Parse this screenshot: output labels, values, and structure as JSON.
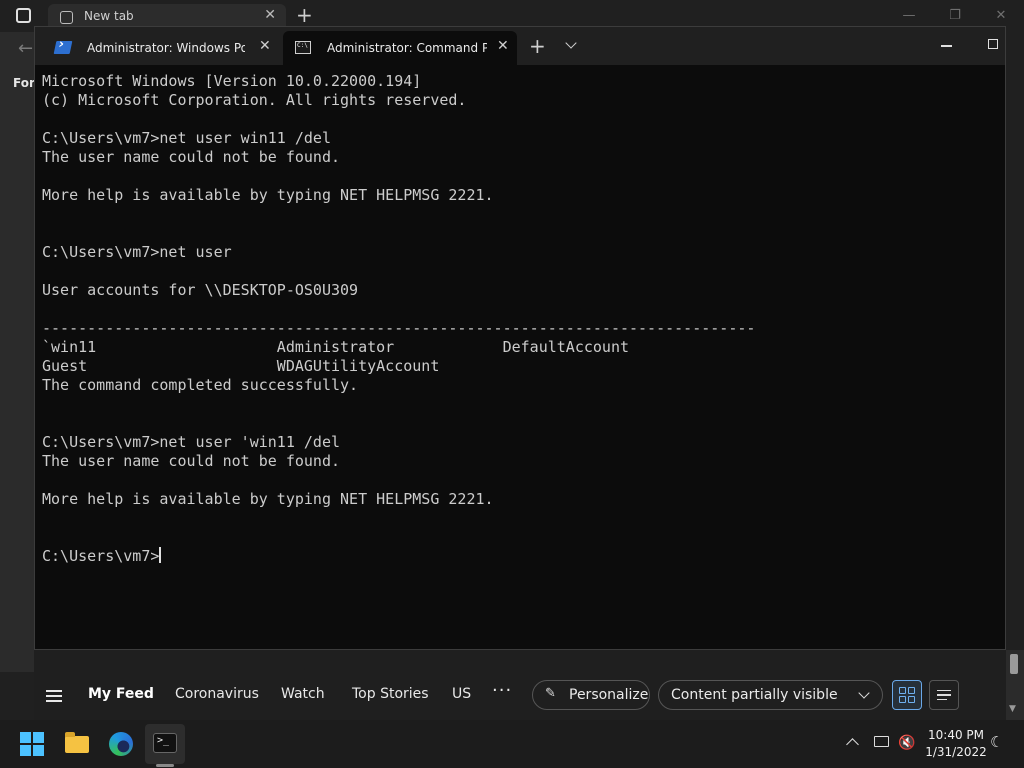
{
  "browser": {
    "tab_title": "New tab",
    "partial_label": "For"
  },
  "terminal": {
    "tabs": [
      {
        "title": "Administrator: Windows PowerShell",
        "active": false
      },
      {
        "title": "Administrator: Command Prompt",
        "active": true
      }
    ],
    "lines": [
      "Microsoft Windows [Version 10.0.22000.194]",
      "(c) Microsoft Corporation. All rights reserved.",
      "",
      "C:\\Users\\vm7>net user win11 /del",
      "The user name could not be found.",
      "",
      "More help is available by typing NET HELPMSG 2221.",
      "",
      "",
      "C:\\Users\\vm7>net user",
      "",
      "User accounts for \\\\DESKTOP-OS0U309",
      "",
      "-------------------------------------------------------------------------------",
      "`win11                    Administrator            DefaultAccount",
      "Guest                     WDAGUtilityAccount",
      "The command completed successfully.",
      "",
      "",
      "C:\\Users\\vm7>net user 'win11 /del",
      "The user name could not be found.",
      "",
      "More help is available by typing NET HELPMSG 2221.",
      "",
      "",
      "C:\\Users\\vm7>"
    ]
  },
  "feed": {
    "items": [
      "My Feed",
      "Coronavirus",
      "Watch",
      "Top Stories",
      "US"
    ],
    "more": "···",
    "personalize_label": "Personalize",
    "content_select_value": "Content partially visible"
  },
  "taskbar": {
    "apps": [
      "start-icon",
      "file-explorer-icon",
      "edge-icon",
      "terminal-icon"
    ],
    "time": "10:40 PM",
    "date": "1/31/2022"
  },
  "colors": {
    "terminal_bg": "#0c0c0c",
    "terminal_fg": "#cccccc",
    "accent": "#4cc2ff"
  }
}
